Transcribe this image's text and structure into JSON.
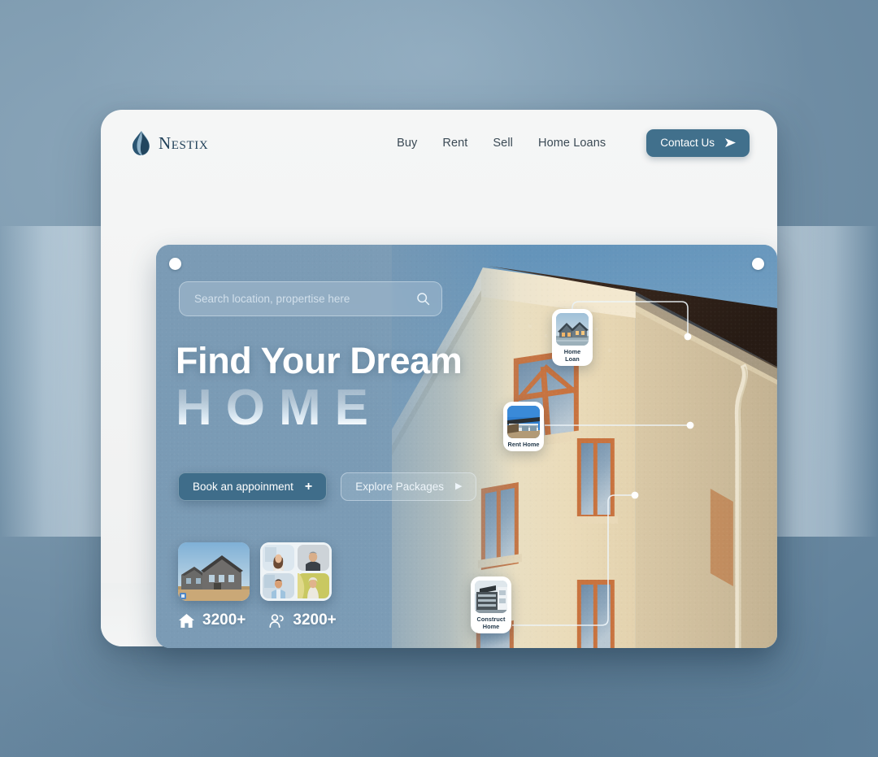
{
  "brand": {
    "name": "Nestix",
    "logo_icon": "water-drop-leaf-icon",
    "logo_color_dark": "#22465f",
    "logo_color_light": "#8fb2c8"
  },
  "nav": {
    "links": [
      {
        "label": "Buy"
      },
      {
        "label": "Rent"
      },
      {
        "label": "Sell"
      },
      {
        "label": "Home Loans"
      }
    ],
    "cta": {
      "label": "Contact Us",
      "icon": "send-arrow-icon",
      "background": "#41708c",
      "text_color": "#ffffff"
    }
  },
  "hero": {
    "search": {
      "placeholder": "Search location, propertise here",
      "value": "",
      "icon": "search-icon"
    },
    "headline": {
      "line1": "Find Your Dream",
      "line2": "HOME"
    },
    "buttons": {
      "primary": {
        "label": "Book an appoinment",
        "icon": "plus-icon"
      },
      "secondary": {
        "label": "Explore Packages",
        "icon": "play-arrow-icon"
      }
    },
    "stats": [
      {
        "icon": "house-icon",
        "value": "3200+",
        "thumb": "house-photo"
      },
      {
        "icon": "users-icon",
        "value": "3200+",
        "thumb": "people-avatars"
      }
    ],
    "feature_cards": [
      {
        "id": "home-loan",
        "label": "Home Loan",
        "thumb": "suburban-house-photo"
      },
      {
        "id": "rent-home",
        "label": "Rent Home",
        "thumb": "modern-villa-photo"
      },
      {
        "id": "construct-home",
        "label": "Construct Home",
        "thumb": "construction-building-photo"
      }
    ],
    "corner_dots": 2,
    "background_image": "cream-stucco-house-against-blue-sky"
  },
  "theme": {
    "page_background": "#7d9ab0",
    "card_background": "#f3f4f4",
    "hero_tint": "#7a9ab4",
    "accent": "#41708c",
    "house_wall": "#f0e3c3",
    "house_roof": "#3a2a20",
    "window_frame": "#c8733f",
    "sky": "#7aa5c5"
  }
}
